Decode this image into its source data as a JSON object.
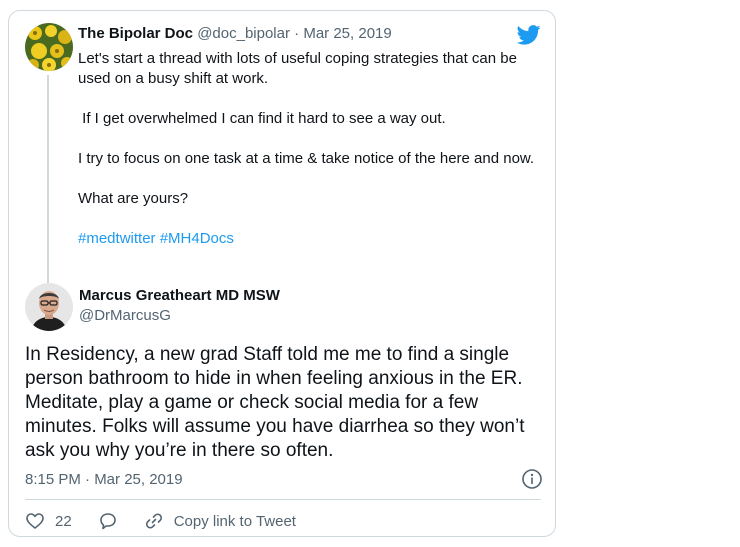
{
  "parent_tweet": {
    "author_name": "The Bipolar Doc",
    "author_handle": "@doc_bipolar",
    "separator": " · ",
    "date": "Mar 25, 2019",
    "paragraphs": [
      "Let's start a thread with lots of useful coping strategies that can be used on a busy shift at work.",
      " If I get overwhelmed I can find it hard to see a way out.",
      "I try to focus on one task at a time & take notice of the here and now.",
      "What are yours?"
    ],
    "hashtags": [
      "#medtwitter",
      "#MH4Docs"
    ]
  },
  "main_tweet": {
    "author_name": "Marcus Greatheart MD MSW",
    "author_handle": "@DrMarcusG",
    "text": "In Residency, a new grad Staff told me me to find a single person bathroom to hide in when feeling anxious in the ER. Meditate, play a game or check social media for a few minutes. Folks will assume you have diarrhea so they won’t ask you why you’re in there so often.",
    "timestamp": "8:15 PM · Mar 25, 2019",
    "like_count": "22",
    "copy_link_label": "Copy link to Tweet"
  },
  "icons": {
    "brand": "twitter-bird-icon",
    "info": "info-icon",
    "like": "heart-icon",
    "reply": "reply-bubble-icon",
    "copy": "link-icon"
  },
  "colors": {
    "brand_blue": "#1d9bf0",
    "text": "#0f1419",
    "secondary_text": "#536471",
    "border": "#cfd9de"
  }
}
